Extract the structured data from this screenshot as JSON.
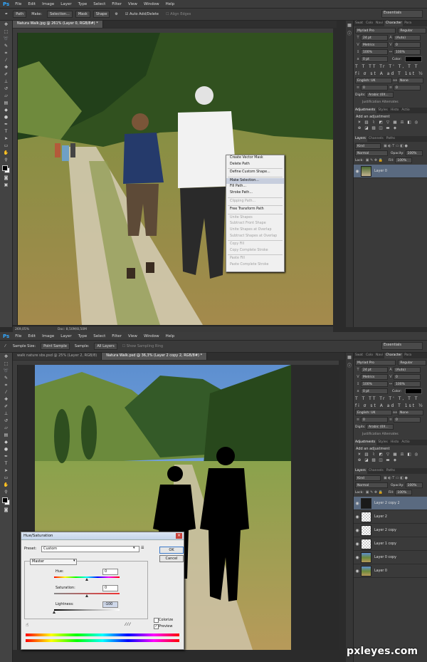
{
  "menubar": {
    "logo": "Ps",
    "items": [
      "File",
      "Edit",
      "Image",
      "Layer",
      "Type",
      "Select",
      "Filter",
      "View",
      "Window",
      "Help"
    ]
  },
  "top": {
    "options": {
      "mode": "Path",
      "make_label": "Make:",
      "selection_btn": "Selection...",
      "mask_btn": "Mask",
      "shape_btn": "Shape",
      "auto_add_delete": "Auto Add/Delete",
      "align_edges": "Align Edges",
      "workspace": "Essentials"
    },
    "tab": "Natura Walk.jpg @ 261% (Layer 0, RGB/8#) *",
    "status": {
      "zoom": "269,05%",
      "doc": "Doc: 8,50M/8,50M"
    },
    "context_menu": [
      {
        "label": "Create Vector Mask",
        "state": "normal"
      },
      {
        "label": "Delete Path",
        "state": "normal"
      },
      {
        "sep": true
      },
      {
        "label": "Define Custom Shape...",
        "state": "normal"
      },
      {
        "sep": true
      },
      {
        "label": "Make Selection...",
        "state": "highlight"
      },
      {
        "label": "Fill Path...",
        "state": "normal"
      },
      {
        "label": "Stroke Path...",
        "state": "normal"
      },
      {
        "sep": true
      },
      {
        "label": "Clipping Path...",
        "state": "disabled"
      },
      {
        "sep": true
      },
      {
        "label": "Free Transform Path",
        "state": "normal"
      },
      {
        "sep": true
      },
      {
        "label": "Unite Shapes",
        "state": "disabled"
      },
      {
        "label": "Subtract Front Shape",
        "state": "disabled"
      },
      {
        "label": "Unite Shapes at Overlap",
        "state": "disabled"
      },
      {
        "label": "Subtract Shapes at Overlap",
        "state": "disabled"
      },
      {
        "sep": true
      },
      {
        "label": "Copy Fill",
        "state": "disabled"
      },
      {
        "label": "Copy Complete Stroke",
        "state": "disabled"
      },
      {
        "sep": true
      },
      {
        "label": "Paste Fill",
        "state": "disabled"
      },
      {
        "label": "Paste Complete Stroke",
        "state": "disabled"
      }
    ],
    "character": {
      "tabs": [
        "Swat",
        "Colo",
        "Navi",
        "Character",
        "Para"
      ],
      "font": "Myriad Pro",
      "style": "Regular",
      "size": "24 pt",
      "leading": "(Auto)",
      "kerning": "Metrics",
      "tracking": "0",
      "vscale": "100%",
      "hscale": "100%",
      "baseline": "0 pt",
      "color_label": "Color:",
      "language": "English: UK",
      "antialias": "None",
      "num1": "0",
      "num2": "0",
      "digits_label": "Digits:",
      "digits": "Arabic (0X...",
      "justification": "Justification Alternates"
    },
    "adjustments": {
      "tabs": [
        "Adjustments",
        "Styles",
        "Histo",
        "Actio"
      ],
      "title": "Add an adjustment"
    },
    "layers": {
      "tabs": [
        "Layers",
        "Channels",
        "Paths"
      ],
      "kind": "Kind",
      "blend": "Normal",
      "opacity_label": "Opacity:",
      "opacity": "100%",
      "lock_label": "Lock:",
      "fill_label": "Fill:",
      "fill": "100%",
      "items": [
        {
          "name": "Layer 0",
          "selected": true
        }
      ]
    }
  },
  "bottom": {
    "options": {
      "sample_size_label": "Sample Size:",
      "sample_size": "Point Sample",
      "sample_label": "Sample:",
      "sample": "All Layers",
      "sampling_ring": "Show Sampling Ring",
      "workspace": "Essentials"
    },
    "tabs": [
      {
        "label": "walk nature sbs.psd @ 25% (Layer 2, RGB/8)",
        "active": false
      },
      {
        "label": "Natura Walk.psd @ 36,3% (Layer 2 copy 2, RGB/8#) *",
        "active": true
      }
    ],
    "layers": {
      "items": [
        {
          "name": "Layer 2 copy 2",
          "selected": true,
          "kind": "dark"
        },
        {
          "name": "Layer 2",
          "selected": false,
          "kind": "checker"
        },
        {
          "name": "Layer 2 copy",
          "selected": false,
          "kind": "checker"
        },
        {
          "name": "Layer 1 copy",
          "selected": false,
          "kind": "checker"
        },
        {
          "name": "Layer 0 copy",
          "selected": false,
          "kind": "photo"
        },
        {
          "name": "Layer 0",
          "selected": false,
          "kind": "photo"
        }
      ]
    },
    "dialog": {
      "title": "Hue/Saturation",
      "preset_label": "Preset:",
      "preset": "Custom",
      "channel": "Master",
      "hue_label": "Hue:",
      "hue": "0",
      "saturation_label": "Saturation:",
      "saturation": "0",
      "lightness_label": "Lightness:",
      "lightness": "-100",
      "hue_pos": 0.5,
      "sat_pos": 0.5,
      "light_pos": 0.0,
      "colorize_label": "Colorize",
      "colorize": false,
      "preview_label": "Preview",
      "preview": true,
      "ok": "OK",
      "cancel": "Cancel"
    }
  },
  "watermark": "pxleyes.com",
  "colors": {
    "accent": "#31a8ff",
    "selected_layer": "#5a6a80",
    "sky": "#5d8fd0"
  }
}
